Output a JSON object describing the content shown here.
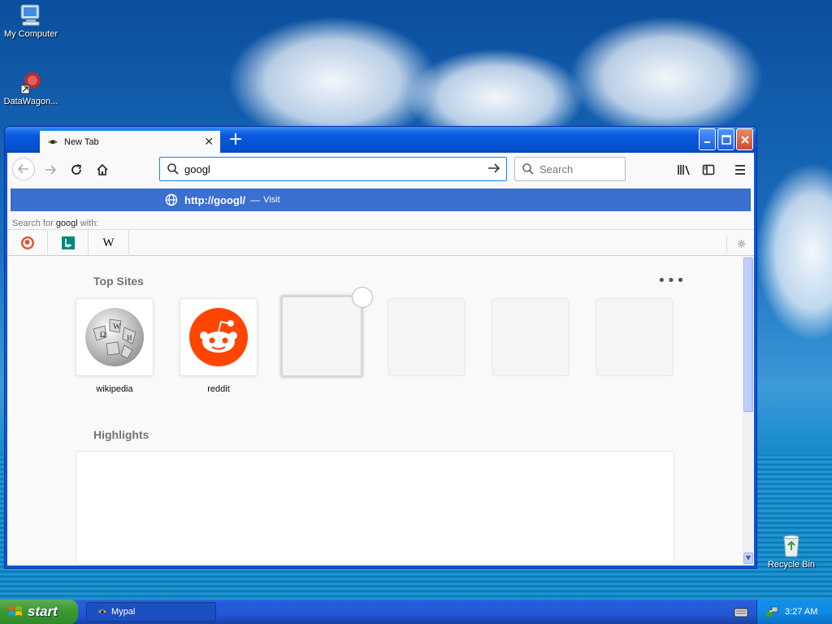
{
  "desktop": {
    "icons": [
      {
        "label": "My Computer"
      },
      {
        "label": "DataWagon..."
      },
      {
        "label": "Recycle Bin"
      }
    ]
  },
  "browser": {
    "tab": {
      "title": "New Tab"
    },
    "url_value": "googl",
    "search_placeholder": "Search",
    "suggestion": {
      "url": "http://googl/",
      "dash": "—",
      "action": "Visit"
    },
    "search_with": {
      "prefix": "Search for ",
      "term": "googl",
      "suffix": " with:"
    },
    "engines": [
      "DuckDuckGo",
      "Bing",
      "Wikipedia"
    ],
    "top_sites": {
      "title": "Top Sites",
      "more": "•••",
      "tiles": [
        {
          "label": "wikipedia"
        },
        {
          "label": "reddit"
        }
      ]
    },
    "highlights": {
      "title": "Highlights"
    }
  },
  "taskbar": {
    "start_label": "start",
    "window_item": "Mypal",
    "clock": "3:27 AM"
  },
  "colors": {
    "accent": "#0a84ff",
    "suggestion_bg": "#3b6fd0",
    "reddit": "#ff4500",
    "titlebar": "#0550d0"
  }
}
